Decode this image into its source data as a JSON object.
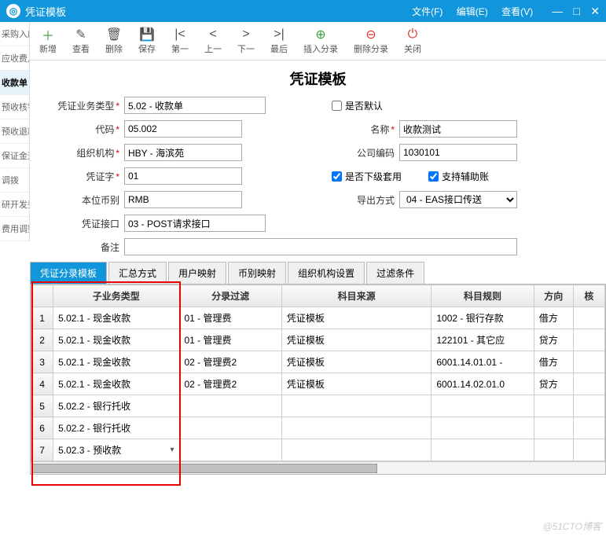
{
  "titlebar": {
    "title": "凭证模板"
  },
  "menus": {
    "file": "文件(F)",
    "edit": "编辑(E)",
    "view": "查看(V)"
  },
  "winbtns": {
    "min": "—",
    "max": "□",
    "close": "✕"
  },
  "sidebar": [
    "采购入库",
    "应收费月",
    "收款单",
    "预收核销",
    "预收退款",
    "保证金退",
    "调拨",
    "研开发费",
    "费用调整"
  ],
  "toolbar": [
    {
      "icon": "＋",
      "cls": "green",
      "label": "新增"
    },
    {
      "icon": "✎",
      "cls": "",
      "label": "查看"
    },
    {
      "icon": "🗑",
      "cls": "",
      "label": "删除"
    },
    {
      "icon": "💾",
      "cls": "",
      "label": "保存"
    },
    {
      "icon": "|<",
      "cls": "",
      "label": "第一"
    },
    {
      "icon": "<",
      "cls": "",
      "label": "上一"
    },
    {
      "icon": ">",
      "cls": "",
      "label": "下一"
    },
    {
      "icon": ">|",
      "cls": "",
      "label": "最后"
    },
    {
      "icon": "⊕",
      "cls": "green",
      "label": "插入分录"
    },
    {
      "icon": "⊖",
      "cls": "red",
      "label": "删除分录"
    },
    {
      "icon": "⏻",
      "cls": "red",
      "label": "关闭"
    }
  ],
  "pageTitle": "凭证模板",
  "form": {
    "bizTypeLabel": "凭证业务类型",
    "bizType": "5.02 - 收款单",
    "isDefaultLabel": "是否默认",
    "isDefault": false,
    "codeLabel": "代码",
    "code": "05.002",
    "nameLabel": "名称",
    "name": "收款测试",
    "orgLabel": "组织机构",
    "org": "HBY - 海滨苑",
    "companyCodeLabel": "公司编码",
    "companyCode": "1030101",
    "voucherWordLabel": "凭证字",
    "voucherWord": "01",
    "subApplyLabel": "是否下级套用",
    "subApply": true,
    "auxLabel": "支持辅助账",
    "aux": true,
    "currencyLabel": "本位币别",
    "currency": "RMB",
    "exportLabel": "导出方式",
    "export": "04 - EAS接口传送",
    "apiLabel": "凭证接口",
    "api": "03 - POST请求接口",
    "remarkLabel": "备注",
    "remark": ""
  },
  "tabs": [
    "凭证分录模板",
    "汇总方式",
    "用户映射",
    "币别映射",
    "组织机构设置",
    "过滤条件"
  ],
  "grid": {
    "headers": [
      "",
      "子业务类型",
      "分录过滤",
      "科目来源",
      "科目规则",
      "方向",
      "核"
    ],
    "rows": [
      {
        "n": "1",
        "biz": "5.02.1 - 现金收款",
        "filter": "01 - 管理费",
        "src": "凭证模板",
        "rule": "1002 - 银行存款",
        "dir": "借方"
      },
      {
        "n": "2",
        "biz": "5.02.1 - 现金收款",
        "filter": "01 - 管理费",
        "src": "凭证模板",
        "rule": "122101 - 其它应",
        "dir": "贷方"
      },
      {
        "n": "3",
        "biz": "5.02.1 - 现金收款",
        "filter": "02 - 管理费2",
        "src": "凭证模板",
        "rule": "6001.14.01.01 -",
        "dir": "借方"
      },
      {
        "n": "4",
        "biz": "5.02.1 - 现金收款",
        "filter": "02 - 管理费2",
        "src": "凭证模板",
        "rule": "6001.14.02.01.0",
        "dir": "贷方"
      },
      {
        "n": "5",
        "biz": "5.02.2 - 银行托收",
        "filter": "",
        "src": "",
        "rule": "",
        "dir": ""
      },
      {
        "n": "6",
        "biz": "5.02.2 - 银行托收",
        "filter": "",
        "src": "",
        "rule": "",
        "dir": ""
      },
      {
        "n": "7",
        "biz": "5.02.3 - 预收款",
        "filter": "",
        "src": "",
        "rule": "",
        "dir": "",
        "dd": true
      }
    ]
  },
  "watermark": "@51CTO博客"
}
